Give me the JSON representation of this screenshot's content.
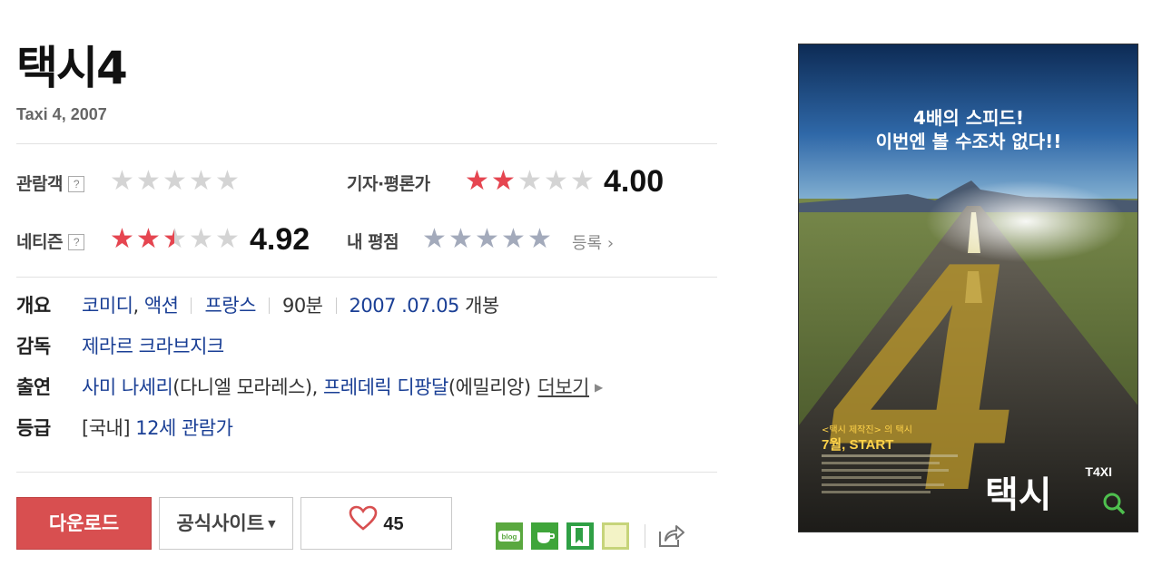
{
  "movie": {
    "title": "택시4",
    "subtitle": "Taxi 4, 2007"
  },
  "ratings": {
    "audience": {
      "label": "관람객",
      "help": "?",
      "stars": 0
    },
    "critics": {
      "label": "기자·평론가",
      "stars": 2.0,
      "score": "4.00"
    },
    "netizen": {
      "label": "네티즌",
      "help": "?",
      "stars": 2.46,
      "score": "4.92"
    },
    "mine": {
      "label": "내 평점",
      "stars": 0,
      "register": "등록"
    }
  },
  "info": {
    "overview": {
      "label": "개요",
      "genre1": "코미디",
      "comma": ",",
      "genre2": "액션",
      "country": "프랑스",
      "runtime": "90분",
      "release_date": "2007 .07.05",
      "release_suffix": "개봉"
    },
    "director": {
      "label": "감독",
      "name": "제라르 크라브지크"
    },
    "cast": {
      "label": "출연",
      "actor1": "사미 나세리",
      "role1": "(다니엘 모라레스),",
      "actor2": "프레데릭 디팡달",
      "role2": "(에밀리앙)",
      "more": "더보기"
    },
    "rating": {
      "label": "등급",
      "region": "[국내]",
      "grade": "12세 관람가"
    }
  },
  "actions": {
    "download": "다운로드",
    "official_site": "공식사이트",
    "like_count": "45"
  },
  "share": {
    "icons": [
      "blog-icon",
      "cafe-icon",
      "bookmark-icon",
      "memo-icon",
      "share-icon"
    ],
    "colors": [
      "#5aa83f",
      "#3fa53a",
      "#2fa045",
      "#c6d47a"
    ]
  },
  "poster": {
    "tagline1": "4배의 스피드!",
    "tagline2": "이번엔 볼 수조차 없다!!",
    "number": "4",
    "credit": "<택시 제작진> 의 택시",
    "release": "7월, START",
    "brand": "T4XI",
    "poster_title": "택시"
  }
}
